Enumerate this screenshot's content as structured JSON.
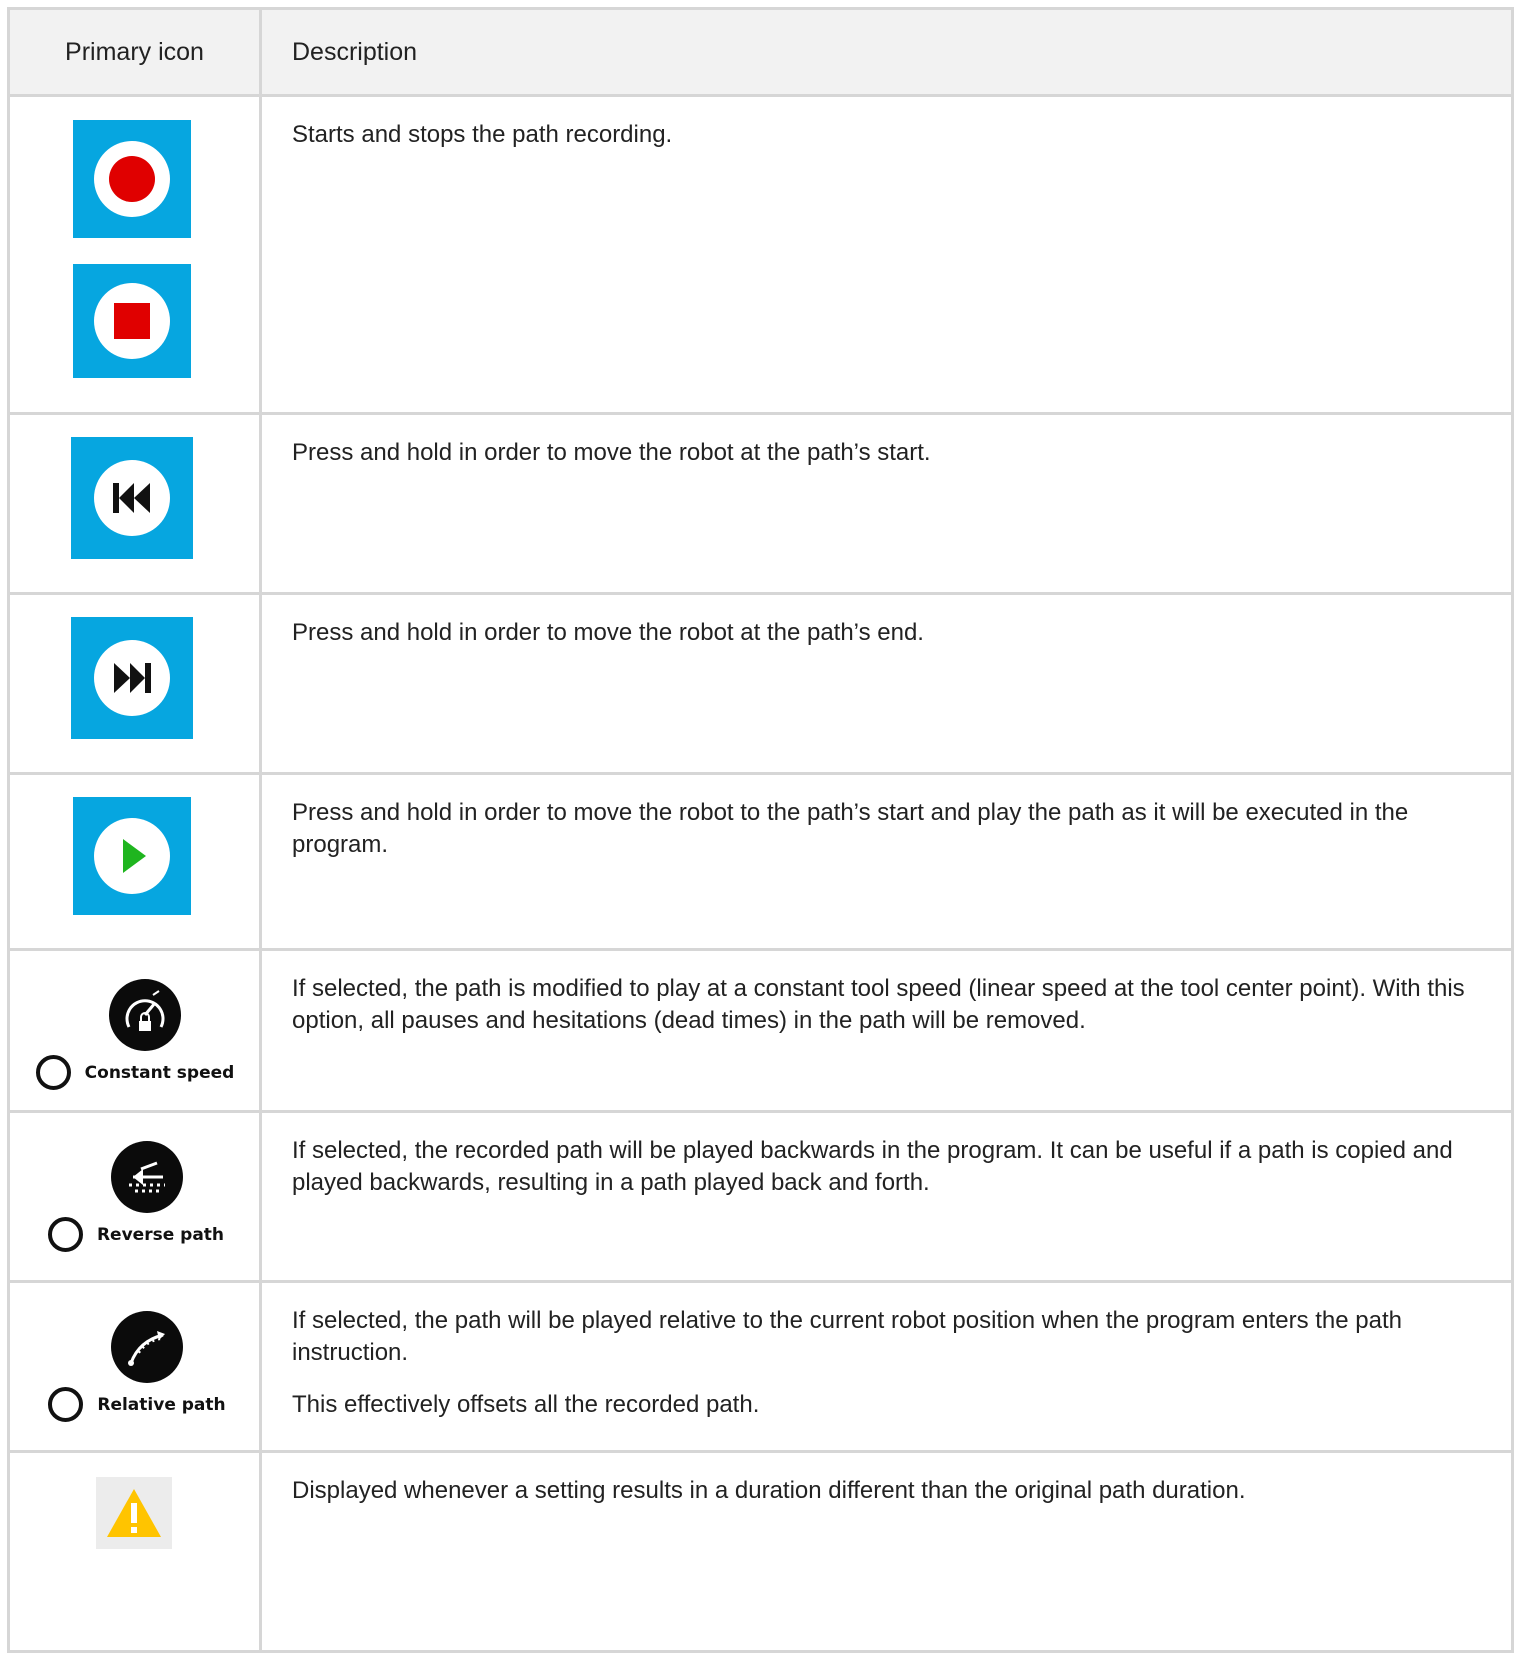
{
  "table": {
    "headers": {
      "icon": "Primary icon",
      "description": "Description"
    },
    "rows": [
      {
        "icons": [
          "record-icon",
          "stop-icon"
        ],
        "paragraphs": [
          "Starts and stops the path recording."
        ]
      },
      {
        "icons": [
          "skip-to-start-icon"
        ],
        "paragraphs": [
          "Press and hold in order to move the robot at the path’s start."
        ]
      },
      {
        "icons": [
          "skip-to-end-icon"
        ],
        "paragraphs": [
          "Press and hold in order to move the robot at the path’s end."
        ]
      },
      {
        "icons": [
          "play-icon"
        ],
        "paragraphs": [
          "Press and hold in order to move the robot to the path’s start and play the path as it will be executed in the program."
        ]
      },
      {
        "icons": [
          "speedometer-icon"
        ],
        "option_label": "Constant speed",
        "paragraphs": [
          "If selected, the path is modified to play at a constant tool speed (linear speed at the tool center point). With this option, all pauses and hesitations (dead times) in the path will be removed."
        ]
      },
      {
        "icons": [
          "reverse-path-icon"
        ],
        "option_label": "Reverse path",
        "paragraphs": [
          "If selected, the recorded path will be played backwards in the program. It can be useful if a path is copied and played backwards, resulting in a path played back and forth."
        ]
      },
      {
        "icons": [
          "relative-path-icon"
        ],
        "option_label": "Relative path",
        "paragraphs": [
          "If selected, the path will be played relative to the current robot position when the program enters the path instruction.",
          "This effectively offsets all the recorded path."
        ]
      },
      {
        "icons": [
          "warning-icon"
        ],
        "paragraphs": [
          "Displayed whenever a setting results in a duration different than the original path duration."
        ]
      }
    ]
  },
  "colors": {
    "button_blue": "#06a6e0",
    "record_red": "#e00000",
    "play_green": "#1fb51f",
    "warning_yellow": "#ffc400",
    "grid_line": "#d6d6d6",
    "header_bg": "#f2f2f2"
  }
}
